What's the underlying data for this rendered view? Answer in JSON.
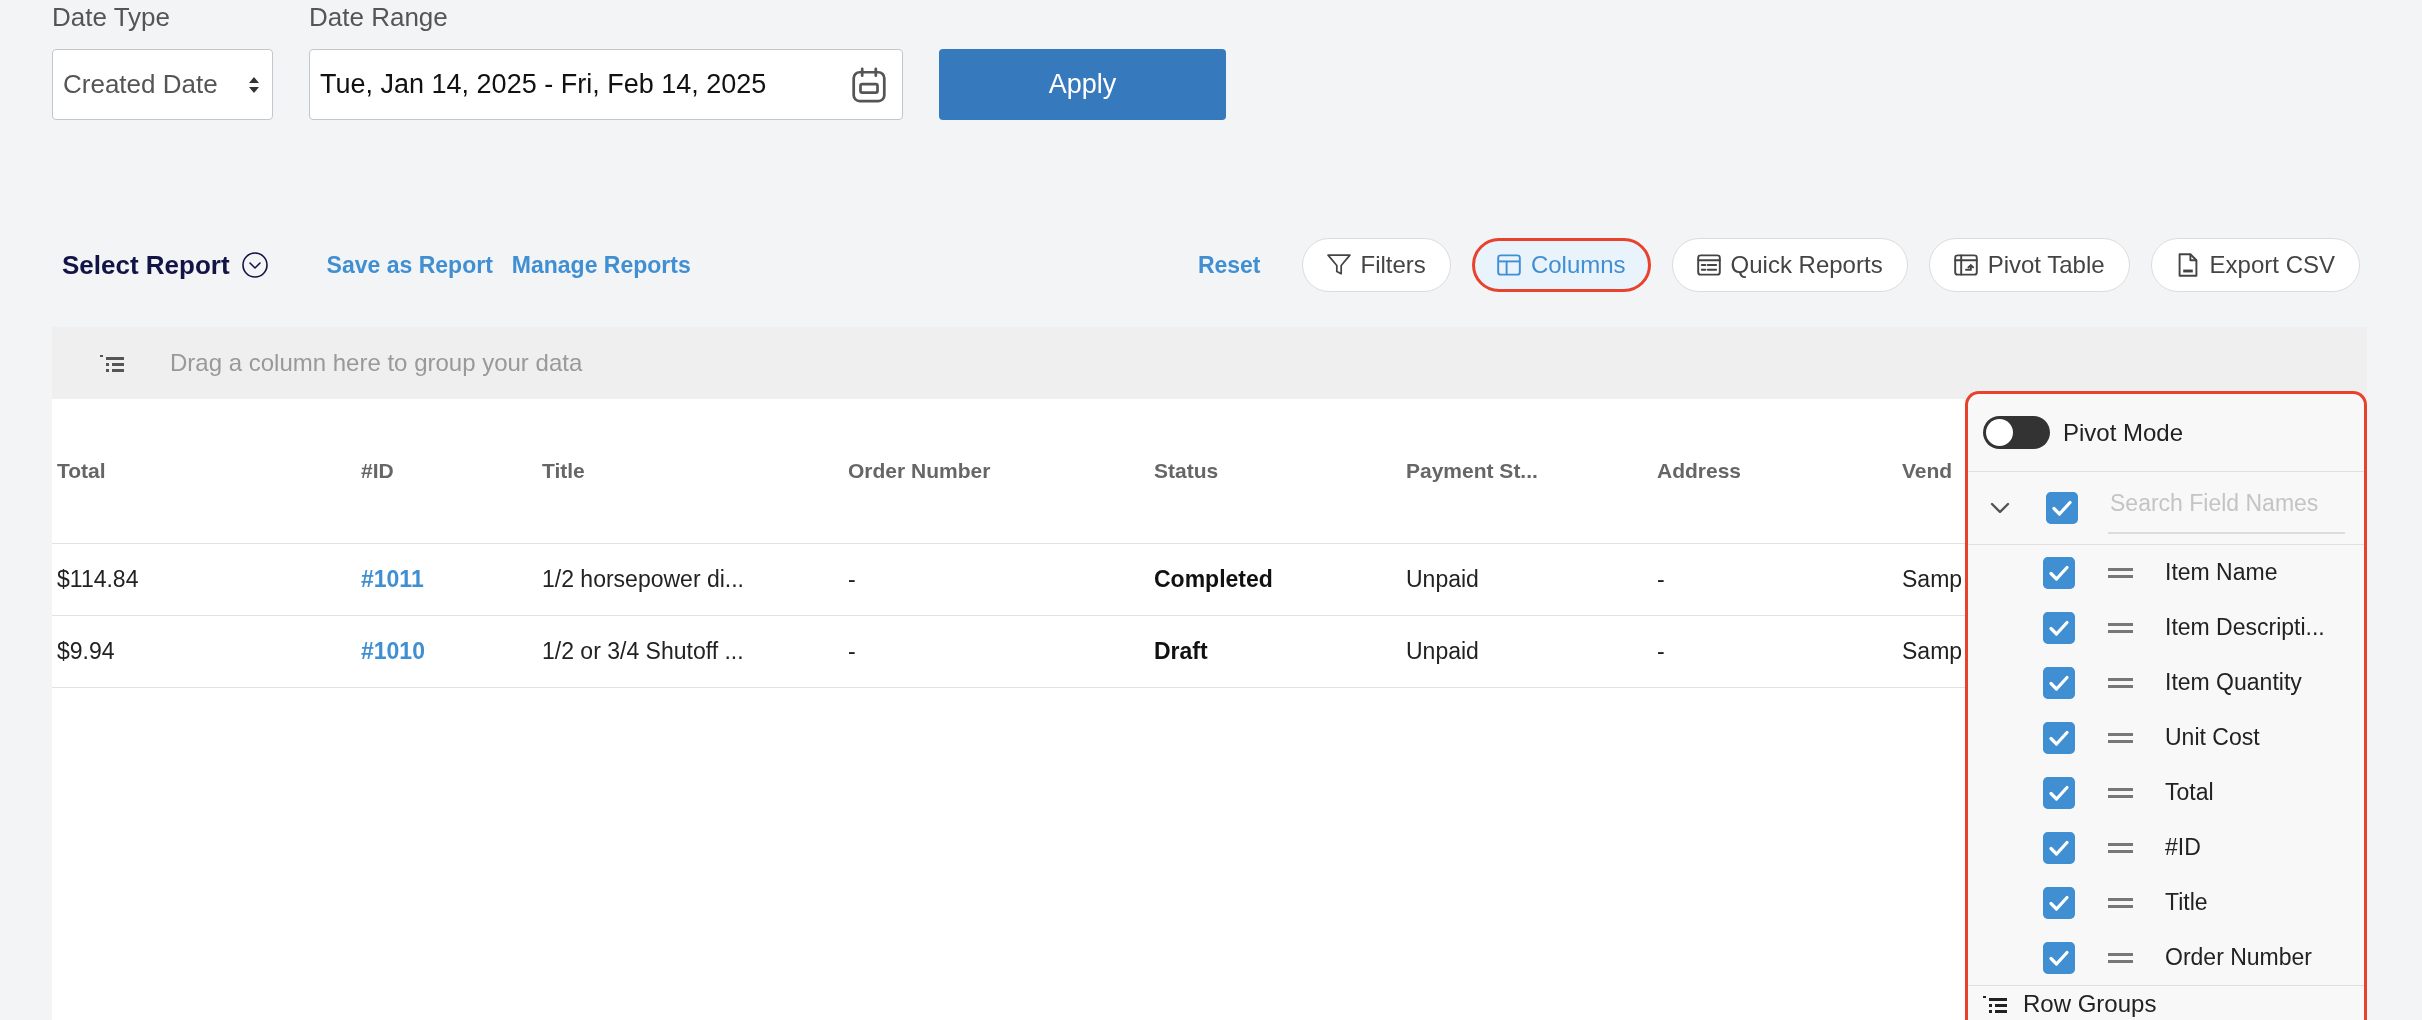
{
  "filters": {
    "date_type": {
      "label": "Date Type",
      "value": "Created Date"
    },
    "date_range": {
      "label": "Date Range",
      "value": "Tue, Jan 14, 2025 - Fri, Feb 14, 2025"
    },
    "apply_button": "Apply"
  },
  "toolbar": {
    "report_select": "Select Report",
    "links": [
      "Save as Report",
      "Manage Reports"
    ],
    "reset": "Reset",
    "buttons": [
      {
        "kind": "filter",
        "label": "Filters",
        "selected": false,
        "highlighted": false
      },
      {
        "kind": "columns",
        "label": "Columns",
        "selected": true,
        "highlighted": true
      },
      {
        "kind": "reports",
        "label": "Quick Reports",
        "selected": false,
        "highlighted": false
      },
      {
        "kind": "pivot",
        "label": "Pivot Table",
        "selected": false,
        "highlighted": false
      },
      {
        "kind": "export",
        "label": "Export CSV",
        "selected": false,
        "highlighted": false
      }
    ]
  },
  "group_bar": {
    "hint": "Drag a column here to group your data"
  },
  "table": {
    "columns": [
      {
        "label": "Total",
        "kind": "text"
      },
      {
        "label": "#ID",
        "kind": "link"
      },
      {
        "label": "Title",
        "kind": "text"
      },
      {
        "label": "Order Number",
        "kind": "text"
      },
      {
        "label": "Status",
        "kind": "bold"
      },
      {
        "label": "Payment St...",
        "kind": "text"
      },
      {
        "label": "Address",
        "kind": "text"
      },
      {
        "label": "Vend",
        "kind": "text"
      }
    ],
    "rows": [
      {
        "cells": [
          "$114.84",
          "#1011",
          "1/2 horsepower di...",
          "-",
          "Completed",
          "Unpaid",
          "-",
          "Samp"
        ]
      },
      {
        "cells": [
          "$9.94",
          "#1010",
          "1/2 or 3/4 Shutoff ...",
          "-",
          "Draft",
          "Unpaid",
          "-",
          "Samp"
        ]
      }
    ]
  },
  "column_panel": {
    "highlighted": true,
    "pivot_mode": {
      "label": "Pivot Mode",
      "on": false
    },
    "select_all": {
      "checked": true,
      "expanded": true
    },
    "search": {
      "placeholder": "Search Field Names"
    },
    "fields": [
      {
        "label": "Item Name",
        "checked": true
      },
      {
        "label": "Item Descripti...",
        "checked": true
      },
      {
        "label": "Item Quantity",
        "checked": true
      },
      {
        "label": "Unit Cost",
        "checked": true
      },
      {
        "label": "Total",
        "checked": true
      },
      {
        "label": "#ID",
        "checked": true
      },
      {
        "label": "Title",
        "checked": true
      },
      {
        "label": "Order Number",
        "checked": true
      }
    ],
    "row_groups_section": "Row Groups"
  }
}
